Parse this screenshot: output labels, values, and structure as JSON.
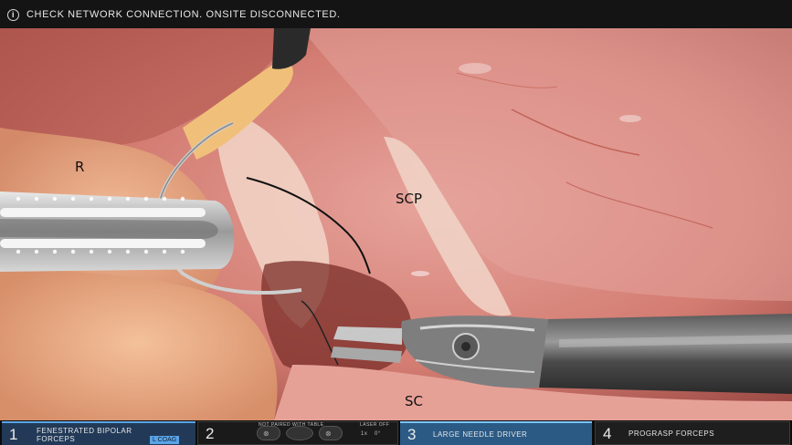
{
  "top_bar": {
    "alert_text": "CHECK NETWORK CONNECTION. ONSITE DISCONNECTED.",
    "alert_icon": "info-icon"
  },
  "annotations": {
    "r": "R",
    "scp": "SCP",
    "sc": "SC"
  },
  "bottom_bar": {
    "arms": [
      {
        "number": "1",
        "tool_line1": "FENESTRATED BIPOLAR",
        "tool_line2": "FORCEPS",
        "energy": "COAG",
        "energy_prefix": "L",
        "accent": "#5aa4e6"
      },
      {
        "number": "2",
        "status": "NOT PAIRED WITH TABLE",
        "laser": "LASER OFF",
        "scale": "1x",
        "angle": "0°"
      },
      {
        "number": "3",
        "tool_line1": "LARGE NEEDLE DRIVER",
        "accent": "#7cc3ff"
      },
      {
        "number": "4",
        "tool_line1": "PROGRASP FORCEPS"
      }
    ]
  }
}
